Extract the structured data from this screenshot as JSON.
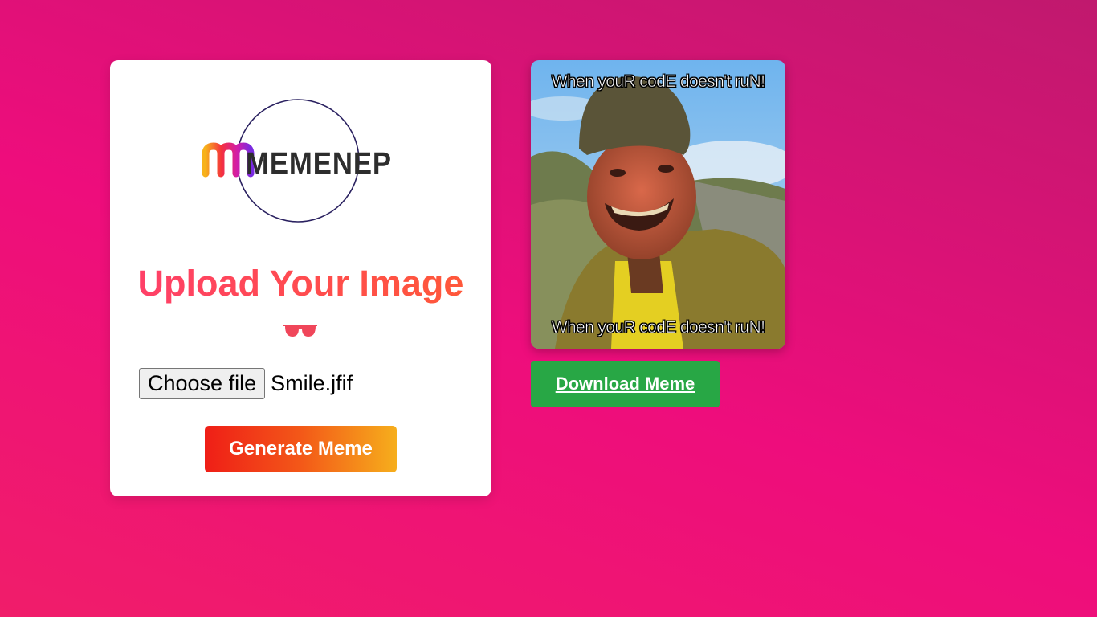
{
  "logo": {
    "text": "MEMENEP",
    "icon": "memenep-logo"
  },
  "upload": {
    "title": "Upload Your Image",
    "glasses_icon": "sunglasses-icon",
    "choose_file_label": "Choose file",
    "selected_file": "Smile.jfif",
    "generate_label": "Generate Meme"
  },
  "meme": {
    "top_text": "When youR codE doesn't ruN!",
    "bottom_text": "When youR codE doesn't ruN!",
    "download_label": "Download Meme"
  },
  "colors": {
    "background": "#ee0d7c",
    "title_gradient_start": "#ff3e6c",
    "title_gradient_end": "#ff5a36",
    "generate_gradient_start": "#ef1e17",
    "generate_gradient_end": "#f6ae1c",
    "download_bg": "#28a745"
  }
}
